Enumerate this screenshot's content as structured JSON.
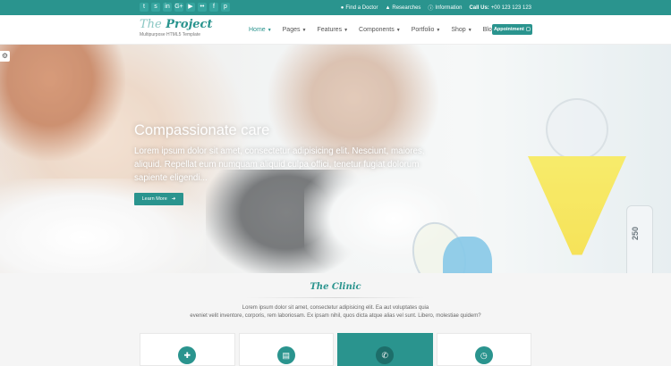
{
  "topbar": {
    "social": [
      {
        "name": "twitter-icon",
        "glyph": "t"
      },
      {
        "name": "skype-icon",
        "glyph": "s"
      },
      {
        "name": "linkedin-icon",
        "glyph": "in"
      },
      {
        "name": "google-plus-icon",
        "glyph": "G+"
      },
      {
        "name": "youtube-icon",
        "glyph": "▶"
      },
      {
        "name": "flickr-icon",
        "glyph": "••"
      },
      {
        "name": "facebook-icon",
        "glyph": "f"
      },
      {
        "name": "pinterest-icon",
        "glyph": "p"
      }
    ],
    "links": {
      "find_doctor": "Find a Doctor",
      "researches": "Researches",
      "information": "Information",
      "call_label": "Call Us:",
      "phone": "+00 123 123 123"
    }
  },
  "header": {
    "logo_the": "The",
    "logo_project": "Project",
    "logo_sub": "Multipurpose HTML5 Template",
    "nav": [
      {
        "label": "Home",
        "active": true
      },
      {
        "label": "Pages",
        "active": false
      },
      {
        "label": "Features",
        "active": false
      },
      {
        "label": "Components",
        "active": false
      },
      {
        "label": "Portfolio",
        "active": false
      },
      {
        "label": "Shop",
        "active": false
      },
      {
        "label": "Blog",
        "active": false
      }
    ],
    "appointment": "Appointment"
  },
  "hero": {
    "title": "Compassionate care",
    "text": "Lorem ipsum dolor sit amet, consectetur adipisicing elit. Nesciunt, maiores, aliquid. Repellat eum numquam aliquid culpa offici, tenetur fugiat dolorum sapiente eligendi...",
    "button": "Learn More",
    "instrument_digits": "250"
  },
  "section": {
    "title": "The Clinic",
    "text_line1": "Lorem ipsum dolor sit amet, consectetur adipisicing elit. Ea aut voluptates quia",
    "text_line2": "eveniet velit inventore, corporis, rem laboriosam. Ex ipsam nihil, quos dicta atque alias vel sunt. Libero, molestiae quidem?",
    "cards": [
      {
        "icon": "plus-square-icon",
        "glyph": "✚",
        "active": false
      },
      {
        "icon": "clipboard-icon",
        "glyph": "▤",
        "active": false
      },
      {
        "icon": "phone-icon",
        "glyph": "✆",
        "active": true
      },
      {
        "icon": "clock-icon",
        "glyph": "◷",
        "active": false
      }
    ]
  },
  "colors": {
    "accent": "#2a948e"
  }
}
